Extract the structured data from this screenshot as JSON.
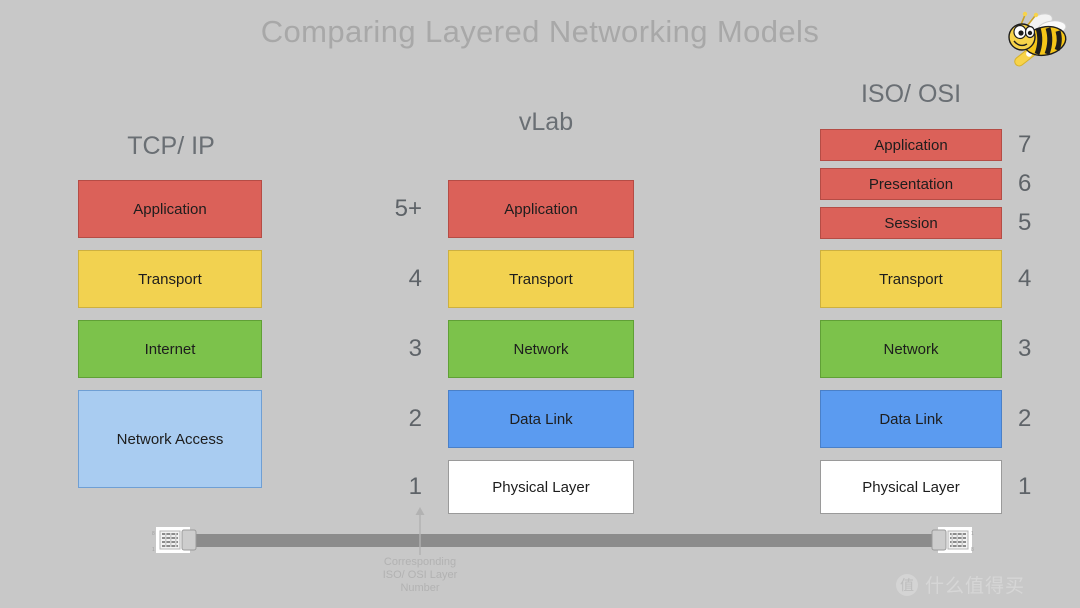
{
  "slide": {
    "title": "Comparing Layered Networking Models",
    "background_color": "#c8c8c8"
  },
  "logo": {
    "name": "bee-mascot",
    "body_color": "#f5c518",
    "stripe_color": "#1d1d1d"
  },
  "colors": {
    "red": "#db6159",
    "yellow": "#f2d250",
    "green": "#7cc24b",
    "blue": "#5b9bf0",
    "light_blue": "#a9ccf1",
    "white": "#ffffff",
    "cable": "#8c8c8c",
    "header_text": "#6a6f74",
    "number_text": "#5e6368",
    "title_text": "#a8a8a8"
  },
  "columns": [
    {
      "id": "tcpip",
      "header": "TCP/ IP",
      "number_side": "none",
      "layers": [
        {
          "label": "Application",
          "color": "red",
          "number": ""
        },
        {
          "label": "Transport",
          "color": "yellow",
          "number": ""
        },
        {
          "label": "Internet",
          "color": "green",
          "number": ""
        },
        {
          "label": "Network Access",
          "color": "light_blue",
          "number": ""
        }
      ]
    },
    {
      "id": "vlab",
      "header": "vLab",
      "number_side": "left",
      "layers": [
        {
          "label": "Application",
          "color": "red",
          "number": "5+"
        },
        {
          "label": "Transport",
          "color": "yellow",
          "number": "4"
        },
        {
          "label": "Network",
          "color": "green",
          "number": "3"
        },
        {
          "label": "Data Link",
          "color": "blue",
          "number": "2"
        },
        {
          "label": "Physical Layer",
          "color": "white",
          "number": "1"
        }
      ]
    },
    {
      "id": "isoosi",
      "header": "ISO/ OSI",
      "number_side": "right",
      "layers": [
        {
          "label": "Application",
          "color": "red",
          "number": "7"
        },
        {
          "label": "Presentation",
          "color": "red",
          "number": "6"
        },
        {
          "label": "Session",
          "color": "red",
          "number": "5"
        },
        {
          "label": "Transport",
          "color": "yellow",
          "number": "4"
        },
        {
          "label": "Network",
          "color": "green",
          "number": "3"
        },
        {
          "label": "Data Link",
          "color": "blue",
          "number": "2"
        },
        {
          "label": "Physical Layer",
          "color": "white",
          "number": "1"
        }
      ]
    }
  ],
  "caption": {
    "line1": "Corresponding",
    "line2": "ISO/ OSI Layer",
    "line3": "Number"
  },
  "cable": {
    "left_connector": "rj45-connector",
    "right_connector": "rj45-connector"
  },
  "watermark": {
    "badge": "值",
    "text": "什么值得买"
  }
}
